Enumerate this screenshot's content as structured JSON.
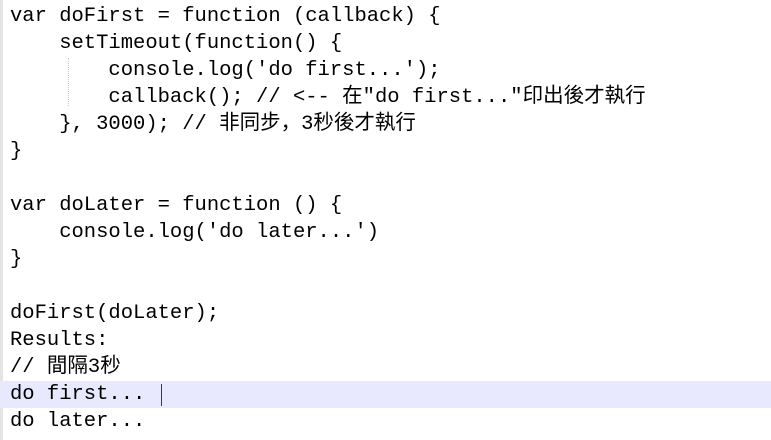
{
  "editor": {
    "lines": [
      "var doFirst = function (callback) {",
      "    setTimeout(function() {",
      "        console.log('do first...');",
      "        callback(); // <-- 在\"do first...\"印出後才執行",
      "    }, 3000); // 非同步，3秒後才執行",
      "}",
      "",
      "var doLater = function () {",
      "    console.log('do later...')",
      "}",
      "",
      "doFirst(doLater);",
      "Results:",
      "// 間隔3秒",
      "do first...",
      "do later..."
    ],
    "current_line_index": 14,
    "colors": {
      "background": "#ffffff",
      "current_line": "#e8e8ff",
      "text": "#000000",
      "caret": "#6a0dad",
      "indent_guide": "#c8c8c8"
    }
  }
}
